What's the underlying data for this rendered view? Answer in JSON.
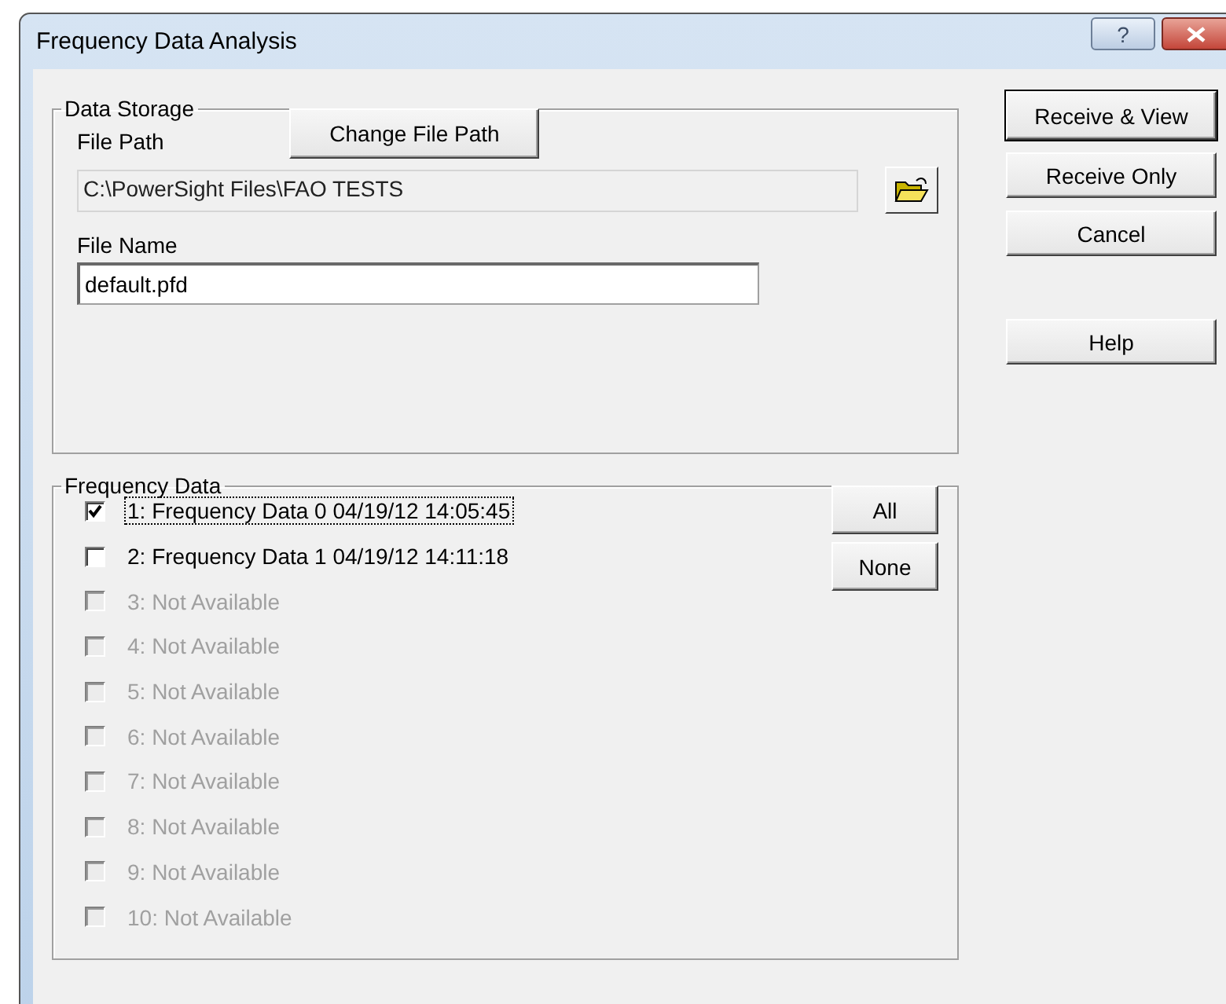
{
  "window": {
    "title": "Frequency Data Analysis",
    "help_glyph": "?"
  },
  "data_storage": {
    "legend": "Data Storage",
    "change_path_button": "Change File Path",
    "file_path_label": "File Path",
    "file_path": "C:\\PowerSight Files\\FAO TESTS",
    "file_name_label": "File Name",
    "file_name": "default.pfd"
  },
  "frequency_data": {
    "legend": "Frequency Data",
    "items": [
      {
        "label": "1: Frequency Data 0 04/19/12 14:05:45",
        "checked": true,
        "disabled": false,
        "focused": true
      },
      {
        "label": "2: Frequency Data 1 04/19/12 14:11:18",
        "checked": false,
        "disabled": false,
        "focused": false
      },
      {
        "label": "3: Not Available",
        "checked": false,
        "disabled": true,
        "focused": false
      },
      {
        "label": "4: Not Available",
        "checked": false,
        "disabled": true,
        "focused": false
      },
      {
        "label": "5: Not Available",
        "checked": false,
        "disabled": true,
        "focused": false
      },
      {
        "label": "6: Not Available",
        "checked": false,
        "disabled": true,
        "focused": false
      },
      {
        "label": "7: Not Available",
        "checked": false,
        "disabled": true,
        "focused": false
      },
      {
        "label": "8: Not Available",
        "checked": false,
        "disabled": true,
        "focused": false
      },
      {
        "label": "9: Not Available",
        "checked": false,
        "disabled": true,
        "focused": false
      },
      {
        "label": "10: Not Available",
        "checked": false,
        "disabled": true,
        "focused": false
      }
    ],
    "buttons": [
      "All",
      "None"
    ]
  },
  "side_buttons": [
    {
      "label": "Receive & View",
      "default": true
    },
    {
      "label": "Receive Only",
      "default": false
    },
    {
      "label": "Cancel",
      "default": false
    },
    {
      "label": "Help",
      "default": false
    }
  ]
}
